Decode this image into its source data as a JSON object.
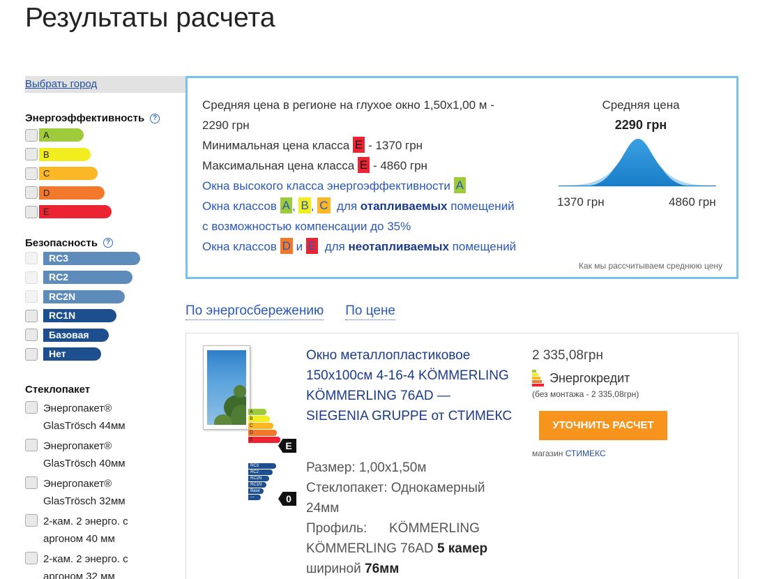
{
  "page": {
    "title": "Результаты расчета"
  },
  "sidebar": {
    "city_link": "Выбрать город",
    "energy": {
      "title": "Энергоэффективность",
      "help": "?",
      "items": [
        {
          "label": "A",
          "color": "#9dcb3b"
        },
        {
          "label": "B",
          "color": "#f1ed1e"
        },
        {
          "label": "C",
          "color": "#fbb725"
        },
        {
          "label": "D",
          "color": "#f2792c"
        },
        {
          "label": "E",
          "color": "#ec2333"
        }
      ]
    },
    "security": {
      "title": "Безопасность",
      "help": "?",
      "items": [
        {
          "label": "RC3",
          "color": "#5e8cba"
        },
        {
          "label": "RC2",
          "color": "#5e8cba"
        },
        {
          "label": "RC2N",
          "color": "#5e8cba"
        },
        {
          "label": "RC1N",
          "color": "#1d4f8f"
        },
        {
          "label": "Базовая",
          "color": "#1d4f8f"
        },
        {
          "label": "Нет",
          "color": "#1d4f8f"
        }
      ]
    },
    "glass": {
      "title": "Стеклопакет",
      "items": [
        {
          "line1": "Энергопакет®",
          "line2": "GlasTrösch 44мм"
        },
        {
          "line1": "Энергопакет®",
          "line2": "GlasTrösch 40мм"
        },
        {
          "line1": "Энергопакет®",
          "line2": "GlasTrösch 32мм"
        },
        {
          "line1": "2-кам. 2 энерго. с",
          "line2": "аргоном 40 мм"
        },
        {
          "line1": "2-кам. 2 энерго. с",
          "line2": "аргоном 32 мм"
        }
      ]
    }
  },
  "info": {
    "line1": "Средняя цена в регионе на глухое окно 1,50х1,00 м -",
    "line2": "2290 грн",
    "min_prefix": "Минимальная цена класса",
    "min_class": "E",
    "min_suffix": "- 1370 грн",
    "max_prefix": "Максимальная цена класса",
    "max_class": "E",
    "max_suffix": "- 4860 грн",
    "high_class_text": "Окна высокого класса энергоэффективности",
    "high_class": "A",
    "heated_prefix": "Окна классов",
    "heated_classes": [
      "A",
      "B",
      "C"
    ],
    "comma": ",",
    "heated_for": "для",
    "heated_bold": "отапливаемых",
    "heated_suffix": "помещений",
    "heated_line2": "с возможностью компенсации до 35%",
    "unheated_prefix": "Окна классов",
    "unheated_classes": [
      "D",
      "E"
    ],
    "unheated_and": "и",
    "unheated_for": "для",
    "unheated_bold": "неотапливаемых",
    "unheated_suffix": "помещений",
    "avg_label": "Средняя цена",
    "avg_value": "2290 грн",
    "min_price": "1370 грн",
    "max_price": "4860 грн",
    "calc_link": "Как мы рассчитываем среднюю цену"
  },
  "sort": {
    "by_energy": "По энергосбережению",
    "by_price": "По цене"
  },
  "product": {
    "title": "Окно металлопластиковое 150х100см 4-16-4 KÖMMERLING KÖMMERLING 76AD — SIEGENIA GRUPPE от СТИМЕКС",
    "energy_labels": [
      "A",
      "B",
      "C",
      "D",
      "E"
    ],
    "energy_class": "E",
    "security_labels": [
      "RC3",
      "RC2",
      "RC2N",
      "RC1N",
      "Base",
      "—"
    ],
    "security_class": "0",
    "size": "Размер: 1,00х1,50м",
    "glass": "Стеклопакет: Однокамерный 24мм",
    "profile_prefix": "Профиль:",
    "profile_name": "KÖMMERLING KÖMMERLING 76AD",
    "profile_chambers": "5 камер",
    "profile_width_prefix": "шириной",
    "profile_width": "76мм",
    "price": "2 335,08грн",
    "credit": "Энергокредит",
    "credit_note": "(без монтажа - 2 335,08грн)",
    "clarify_button": "УТОЧНИТЬ РАСЧЕТ",
    "shop_prefix": "магазин",
    "shop_name": "СТИМЕКС"
  }
}
